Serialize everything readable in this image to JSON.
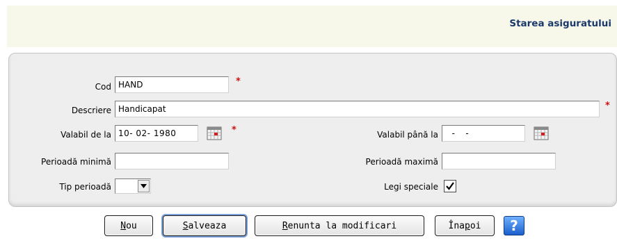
{
  "header": {
    "title": "Starea asiguratului"
  },
  "form": {
    "cod": {
      "label": "Cod",
      "value": "HAND"
    },
    "descriere": {
      "label": "Descriere",
      "value": "Handicapat"
    },
    "valabil_de_la": {
      "label": "Valabil de la",
      "value": "10- 02-  1980"
    },
    "valabil_pana_la": {
      "label": "Valabil până la",
      "value": "  -   -"
    },
    "perioada_minima": {
      "label": "Perioadă minimă",
      "value": ""
    },
    "perioada_maxima": {
      "label": "Perioadă maximă",
      "value": ""
    },
    "tip_perioada": {
      "label": "Tip perioadă",
      "value": ""
    },
    "legi_speciale": {
      "label": "Legi speciale",
      "checked": true
    },
    "required_mark": "*"
  },
  "buttons": {
    "nou": {
      "u": "N",
      "rest": "ou"
    },
    "salveaza": {
      "u": "S",
      "rest": "alveaza"
    },
    "renunta": {
      "u": "R",
      "rest": "enunta la modificari"
    },
    "inapoi": {
      "pre": "Îna",
      "u": "p",
      "rest": "oi"
    },
    "help": "?"
  },
  "colors": {
    "title": "#1b3a6b",
    "required": "#d01010",
    "panel": "#eeeeee",
    "header": "#f7f7ea"
  }
}
